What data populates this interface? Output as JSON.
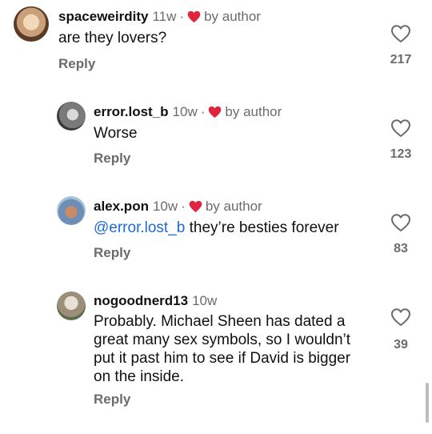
{
  "ui": {
    "reply_label": "Reply",
    "colors": {
      "heart": "#e0243d",
      "muted": "#6b6b6b",
      "mention": "#1f6ad1"
    }
  },
  "comments": [
    {
      "username": "spaceweirdity",
      "time": "11w",
      "separator": "·",
      "liked_by": "by author",
      "text": "are they lovers?",
      "likes": "217"
    },
    {
      "username": "error.lost_b",
      "time": "10w",
      "separator": "·",
      "liked_by": "by author",
      "text": "Worse",
      "likes": "123"
    },
    {
      "username": "alex.pon",
      "time": "10w",
      "separator": "·",
      "liked_by": "by author",
      "mention": "@error.lost_b",
      "text": "they’re besties forever",
      "likes": "83"
    },
    {
      "username": "nogoodnerd13",
      "time": "10w",
      "text_lines": [
        "Probably. Michael Sheen has dated a",
        "great many sex symbols, so I wouldn’t",
        "put it past him to see if David is bigger",
        "on the inside."
      ],
      "likes": "39"
    }
  ]
}
